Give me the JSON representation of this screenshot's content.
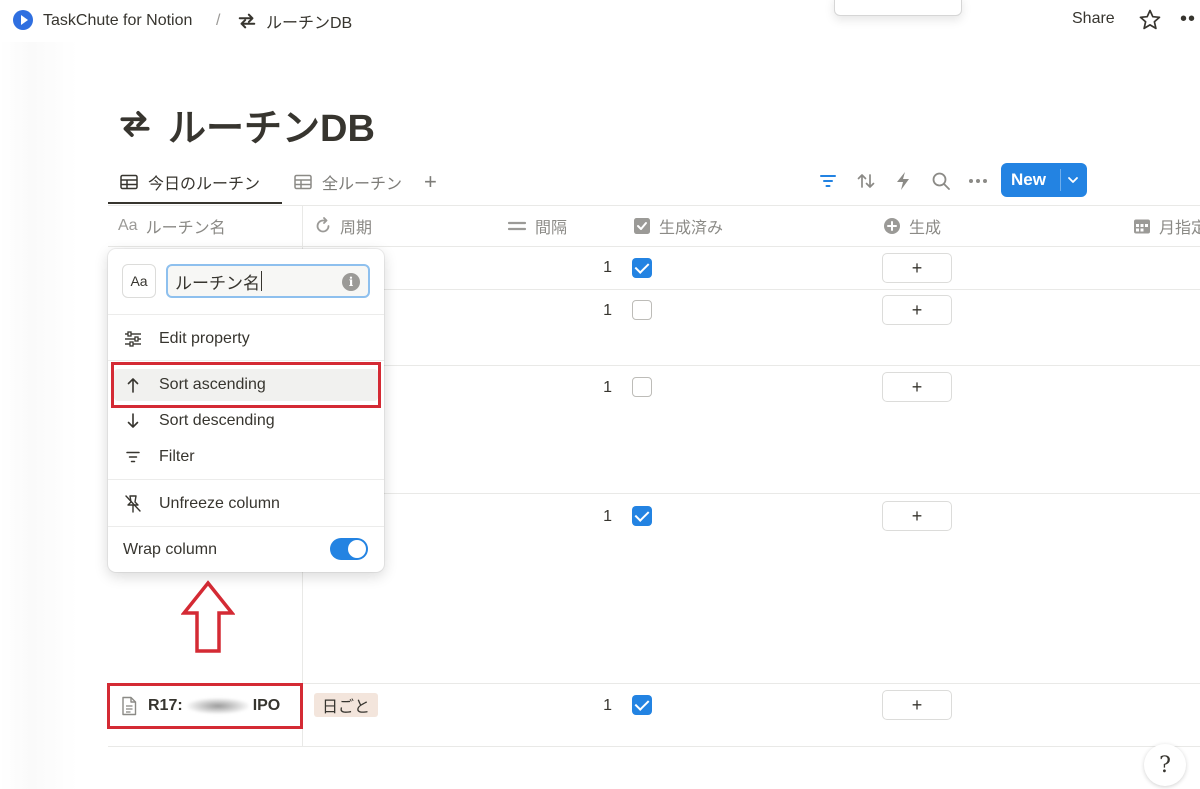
{
  "breadcrumb": {
    "workspace": "TaskChute for Notion",
    "separator": "/",
    "page": "ルーチンDB"
  },
  "topbar": {
    "share_label": "Share",
    "more_label": "••"
  },
  "page": {
    "title": "ルーチンDB"
  },
  "views": {
    "tabs": [
      {
        "label": "今日のルーチン",
        "active": true
      },
      {
        "label": "全ルーチン",
        "active": false
      }
    ],
    "add_label": "+"
  },
  "toolbar": {
    "new_label": "New"
  },
  "table": {
    "columns": [
      {
        "icon": "Aa",
        "label": "ルーチン名"
      },
      {
        "icon": "cycle-icon",
        "label": "周期"
      },
      {
        "icon": "equals-icon",
        "label": "間隔"
      },
      {
        "icon": "checkbox-icon",
        "label": "生成済み"
      },
      {
        "icon": "plus-circle-icon",
        "label": "生成"
      },
      {
        "icon": "calendar-icon",
        "label": "月指定"
      }
    ],
    "rows": [
      {
        "interval": "1",
        "generated": true,
        "button": "+"
      },
      {
        "interval": "1",
        "generated": false,
        "button": "+"
      },
      {
        "interval": "1",
        "generated": false,
        "button": "+"
      },
      {
        "interval": "1",
        "generated": true,
        "button": "+"
      },
      {
        "name_prefix": "R17:",
        "name_suffix": "IPO",
        "cycle": "日ごと",
        "interval": "1",
        "generated": true,
        "button": "+"
      }
    ]
  },
  "menu": {
    "type_icon": "Aa",
    "name_value": "ルーチン名",
    "info_icon": "i",
    "items": {
      "edit_property": "Edit property",
      "sort_ascending": "Sort ascending",
      "sort_descending": "Sort descending",
      "filter": "Filter",
      "unfreeze": "Unfreeze column",
      "wrap": "Wrap column"
    },
    "wrap_enabled": true
  },
  "help": {
    "icon_text": "?"
  },
  "colors": {
    "accent": "#2383e2",
    "highlight_red": "#d42a34",
    "tag_bg": "#f3e5dc"
  }
}
